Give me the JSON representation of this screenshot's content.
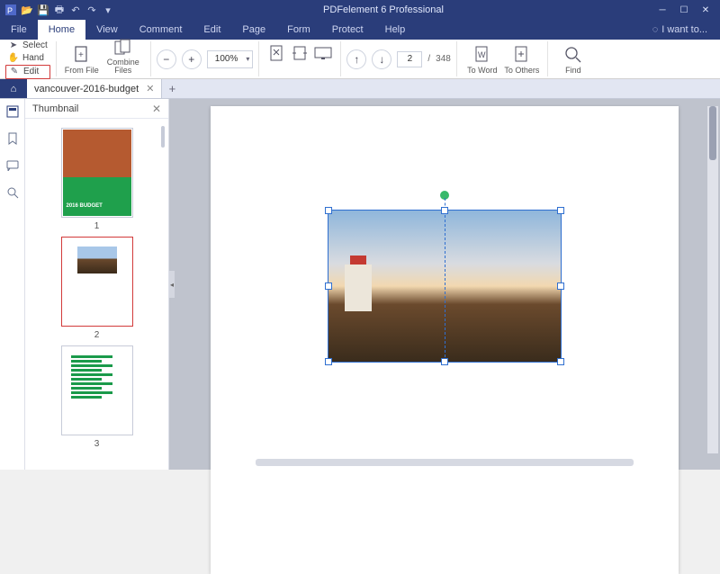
{
  "app": {
    "title": "PDFelement 6 Professional"
  },
  "menubar": {
    "tabs": [
      "File",
      "Home",
      "View",
      "Comment",
      "Edit",
      "Page",
      "Form",
      "Protect",
      "Help"
    ],
    "active": "Home",
    "iwant": "I want to..."
  },
  "ribbon": {
    "select": "Select",
    "hand": "Hand",
    "edit": "Edit",
    "fromfile": "From File",
    "combine": "Combine Files",
    "zoom": "100%",
    "page_current": "2",
    "page_sep": "/",
    "page_total": "348",
    "toword": "To Word",
    "toothers": "To Others",
    "find": "Find"
  },
  "doctab": {
    "name": "vancouver-2016-budget"
  },
  "thumbpanel": {
    "title": "Thumbnail",
    "pages": [
      "1",
      "2",
      "3"
    ],
    "active": "2"
  }
}
